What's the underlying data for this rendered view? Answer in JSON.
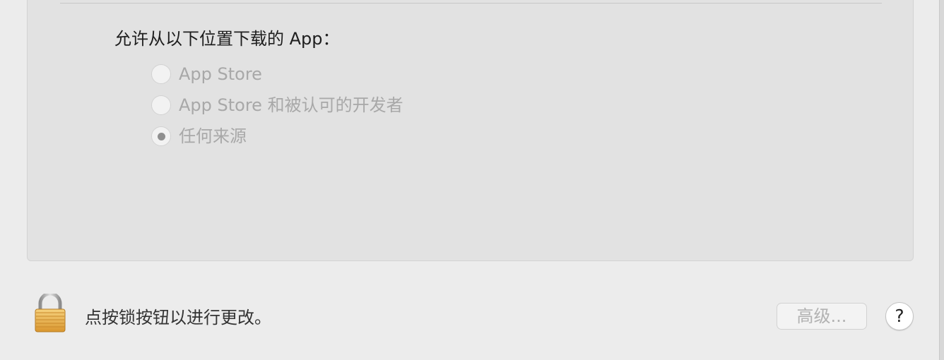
{
  "gatekeeper": {
    "heading": "允许从以下位置下载的 App：",
    "options": [
      {
        "label": "App Store",
        "selected": false,
        "enabled": false
      },
      {
        "label": "App Store 和被认可的开发者",
        "selected": false,
        "enabled": false
      },
      {
        "label": "任何来源",
        "selected": true,
        "enabled": false
      }
    ]
  },
  "footer": {
    "lock_icon": "padlock-locked-icon",
    "lock_message": "点按锁按钮以进行更改。",
    "advanced_button": "高级...",
    "help_button": "?"
  },
  "colors": {
    "panel_bg": "#e2e2e2",
    "window_bg": "#ececec",
    "disabled_text": "#a8a8a8",
    "lock_gold": "#e8b04a"
  }
}
